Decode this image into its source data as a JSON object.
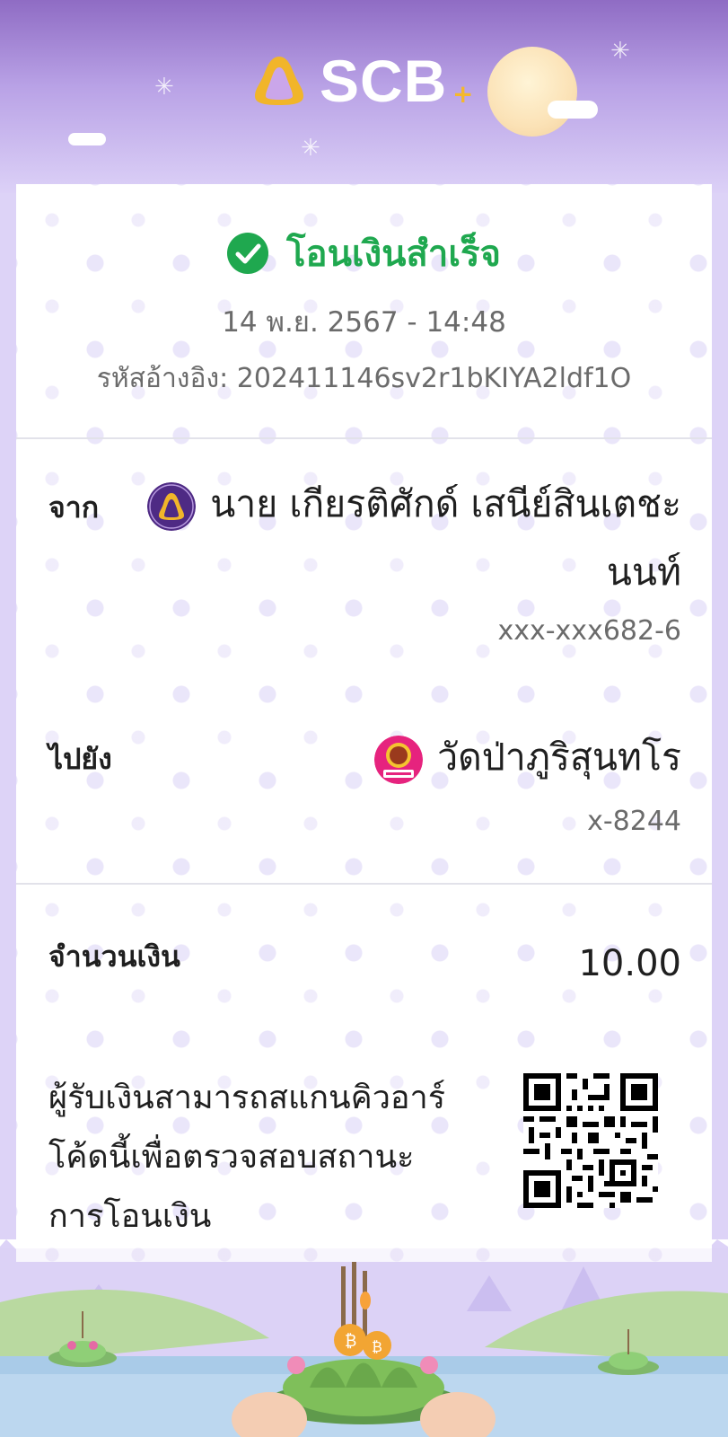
{
  "brand": {
    "name": "SCB",
    "accent_color": "#4e2a84",
    "success_color": "#1fa84f"
  },
  "icons": {
    "logo": "scb-bell-logo-icon",
    "status": "success-check-icon",
    "from_bank": "scb-bank-icon",
    "to_bank": "gsb-bank-icon",
    "qr": "qr-code-icon"
  },
  "status": {
    "text": "โอนเงินสำเร็จ",
    "datetime": "14 พ.ย. 2567 - 14:48",
    "reference_label": "รหัสอ้างอิง:",
    "reference_value": "202411146sv2r1bKIYA2ldf1O"
  },
  "from": {
    "label": "จาก",
    "name_line1": "นาย เกียรติศักด์ เสนีย์สินเตชะ",
    "name_line2": "นนท์",
    "account": "xxx-xxx682-6"
  },
  "to": {
    "label": "ไปยัง",
    "name": "วัดป่าภูริสุนทโร",
    "account": "x-8244"
  },
  "amount": {
    "label": "จำนวนเงิน",
    "value": "10.00"
  },
  "qr_note": {
    "line1": "ผู้รับเงินสามารถสแกนคิวอาร์",
    "line2": "โค้ดนี้เพื่อตรวจสอบสถานะ",
    "line3": "การโอนเงิน"
  }
}
